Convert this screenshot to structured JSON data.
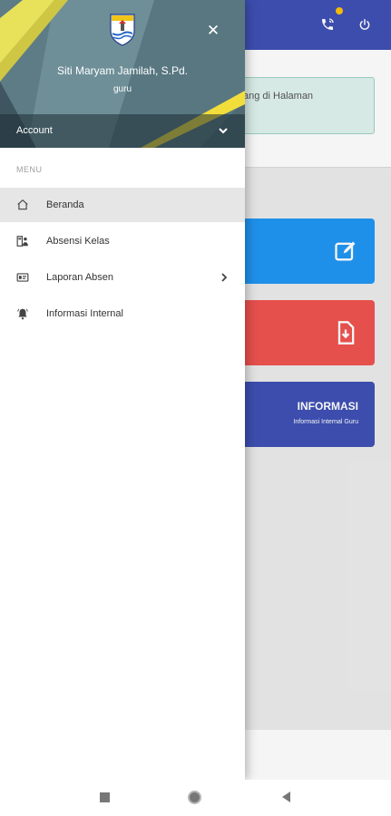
{
  "app": {
    "welcome_text": "ang di Halaman",
    "cards": {
      "informasi_title": "INFORMASI",
      "informasi_sub": "Informasi Internal Guru"
    },
    "colors": {
      "topbar": "#3f51b5",
      "card_blue": "#2196f3",
      "card_red": "#ef5350",
      "card_indigo": "#3f51b5",
      "notification_dot": "#ffc107"
    },
    "icons": [
      "phone-call-icon",
      "power-icon",
      "edit-icon",
      "download-file-icon"
    ]
  },
  "drawer": {
    "user_name": "Siti Maryam Jamilah, S.Pd.",
    "user_role": "guru",
    "account_label": "Account",
    "close_icon": "close-icon",
    "menu_header": "MENU",
    "items": [
      {
        "label": "Beranda",
        "icon": "home-icon",
        "active": true
      },
      {
        "label": "Absensi Kelas",
        "icon": "class-attendance-icon",
        "active": false
      },
      {
        "label": "Laporan Absen",
        "icon": "report-icon",
        "active": false,
        "has_submenu": true
      },
      {
        "label": "Informasi Internal",
        "icon": "bell-icon",
        "active": false
      }
    ]
  },
  "system_nav": [
    "recent-apps-icon",
    "home-circle-icon",
    "back-triangle-icon"
  ]
}
